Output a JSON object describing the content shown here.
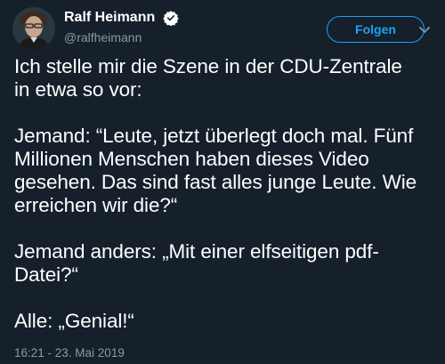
{
  "theme": {
    "background": "#15202b",
    "text": "#ffffff",
    "secondary_text": "#8899a6",
    "accent": "#1da1f2"
  },
  "author": {
    "display_name": "Ralf Heimann",
    "handle": "@ralfheimann",
    "verified": true,
    "avatar_icon": "profile-photo"
  },
  "actions": {
    "follow_label": "Folgen",
    "more_icon": "chevron-down-icon"
  },
  "tweet": {
    "paragraphs": [
      "Ich stelle mir die Szene in der CDU-Zentrale\nin etwa so vor:",
      "Jemand: “Leute, jetzt überlegt doch mal. Fünf\nMillionen Menschen haben dieses Video\ngesehen. Das sind fast alles junge Leute. Wie\nerreichen wir die?“",
      "Jemand anders: „Mit einer elfseitigen pdf-\nDatei?“",
      "Alle: „Genial!“"
    ],
    "timestamp": "16:21 - 23. Mai 2019"
  }
}
